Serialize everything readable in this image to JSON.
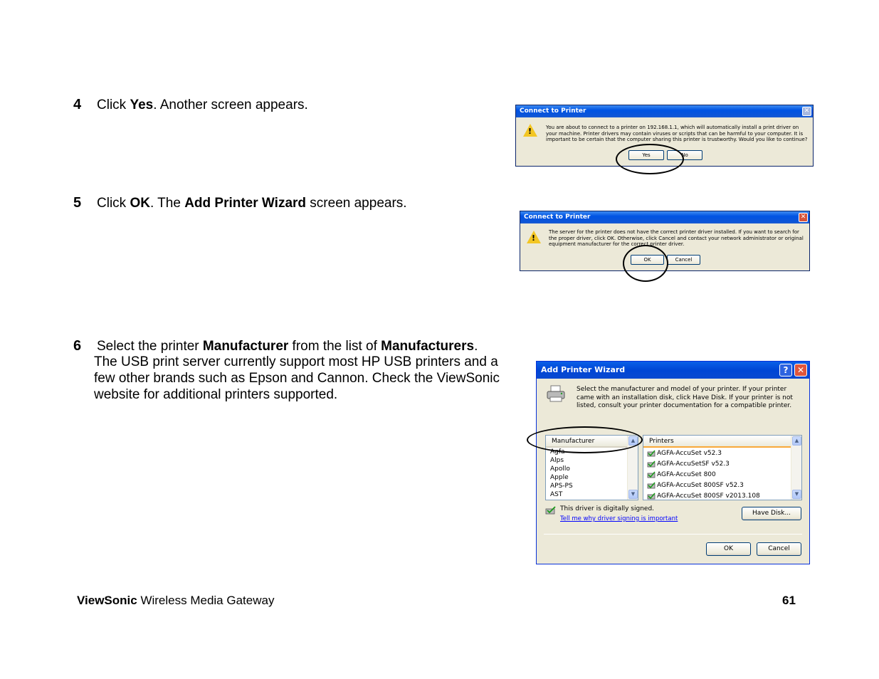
{
  "steps": [
    {
      "num": "4",
      "parts": [
        "Click ",
        "Yes",
        ". Another screen appears."
      ]
    },
    {
      "num": "5",
      "parts": [
        "Click ",
        "OK",
        ". The ",
        "Add Printer Wizard",
        " screen appears."
      ]
    },
    {
      "num": "6",
      "parts": [
        "Select the printer ",
        "Manufacturer",
        " from the list of ",
        "Manufacturers",
        "."
      ],
      "body": "The USB print server currently support most HP USB printers and a few other brands such as Epson and Cannon. Check the ViewSonic website for additional printers supported."
    }
  ],
  "dialog1": {
    "title": "Connect to Printer",
    "message": "You are about to connect to a printer on 192.168.1.1, which will automatically install a print driver on your machine. Printer drivers may contain viruses or scripts that can be harmful to your computer.  It is important to be certain that the computer sharing this printer is trustworthy.  Would you like to continue?",
    "yes_label": "Yes",
    "no_label": "No"
  },
  "dialog2": {
    "title": "Connect to Printer",
    "message": "The server for the printer does not have the correct printer driver installed.  If you want to search for the proper driver, click OK.  Otherwise, click Cancel and contact your network administrator or original equipment manufacturer for the correct printer driver.",
    "ok_label": "OK",
    "cancel_label": "Cancel"
  },
  "wizard": {
    "title": "Add Printer Wizard",
    "help_glyph": "?",
    "close_glyph": "✕",
    "description": "Select the manufacturer and model of your printer. If your printer came with an installation disk, click Have Disk. If your printer is not listed, consult your printer documentation for a compatible printer.",
    "manufacturer_header": "Manufacturer",
    "manufacturers": [
      "Agfa",
      "Alps",
      "Apollo",
      "Apple",
      "APS-PS",
      "AST"
    ],
    "printers_header": "Printers",
    "printers": [
      "AGFA-AccuSet v52.3",
      "AGFA-AccuSetSF v52.3",
      "AGFA-AccuSet 800",
      "AGFA-AccuSet 800SF v52.3",
      "AGFA-AccuSet 800SF v2013.108"
    ],
    "signed_text": "This driver is digitally signed.",
    "signing_link": "Tell me why driver signing is important",
    "have_disk_label": "Have Disk...",
    "ok_label": "OK",
    "cancel_label": "Cancel"
  },
  "footer": {
    "brand": "ViewSonic",
    "product": " Wireless Media Gateway",
    "page": "61"
  },
  "colors": {
    "xp_title_blue": "#0054e3",
    "dialog_face": "#ece9d8",
    "link_blue": "#0000ff"
  }
}
